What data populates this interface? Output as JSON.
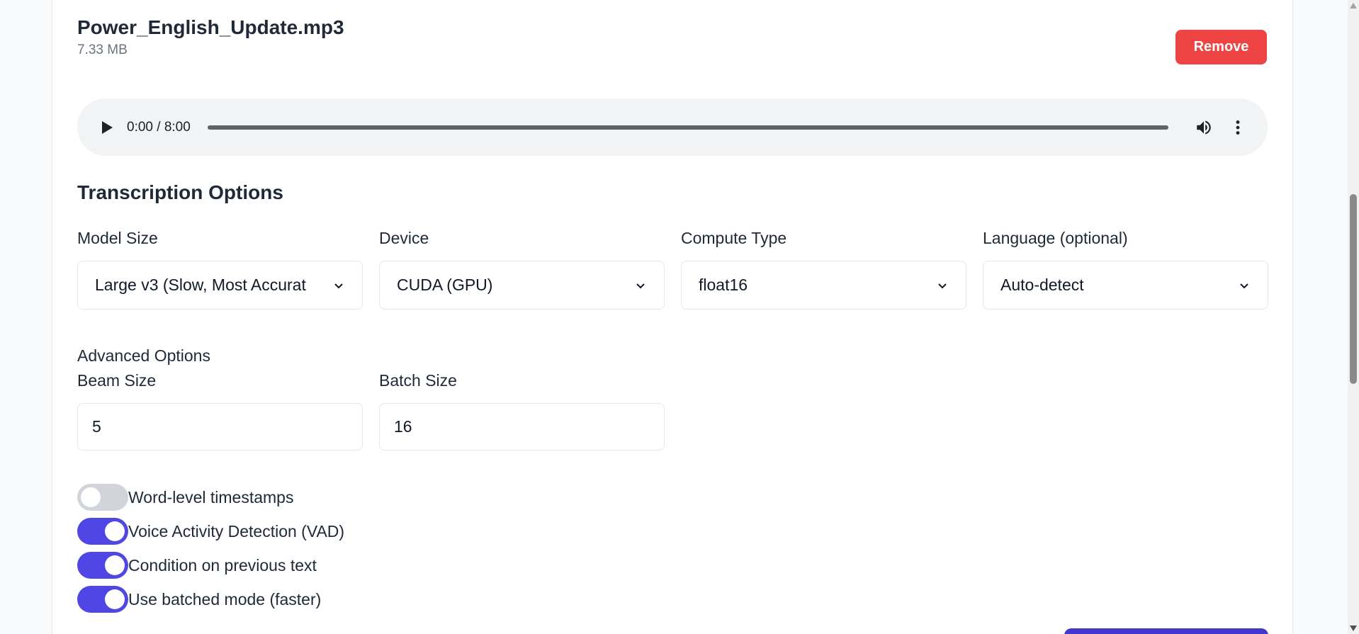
{
  "file": {
    "name": "Power_English_Update.mp3",
    "size": "7.33 MB",
    "remove_label": "Remove"
  },
  "player": {
    "time": "0:00 / 8:00",
    "progress_fraction": 0
  },
  "options": {
    "title": "Transcription Options",
    "fields": [
      {
        "label": "Model Size",
        "value": "Large v3 (Slow, Most Accurat"
      },
      {
        "label": "Device",
        "value": "CUDA (GPU)"
      },
      {
        "label": "Compute Type",
        "value": "float16"
      },
      {
        "label": "Language (optional)",
        "value": "Auto-detect"
      }
    ]
  },
  "advanced": {
    "title": "Advanced Options",
    "beam_size": {
      "label": "Beam Size",
      "value": "5"
    },
    "batch_size": {
      "label": "Batch Size",
      "value": "16"
    }
  },
  "toggles": [
    {
      "label": "Word-level timestamps",
      "on": false
    },
    {
      "label": "Voice Activity Detection (VAD)",
      "on": true
    },
    {
      "label": "Condition on previous text",
      "on": true
    },
    {
      "label": "Use batched mode (faster)",
      "on": true
    }
  ],
  "colors": {
    "accent": "#4f46e5",
    "danger": "#ef4444"
  },
  "icons": {
    "play": "play-icon",
    "volume": "volume-icon",
    "more": "more-vertical-icon",
    "chevron": "chevron-down-icon"
  }
}
